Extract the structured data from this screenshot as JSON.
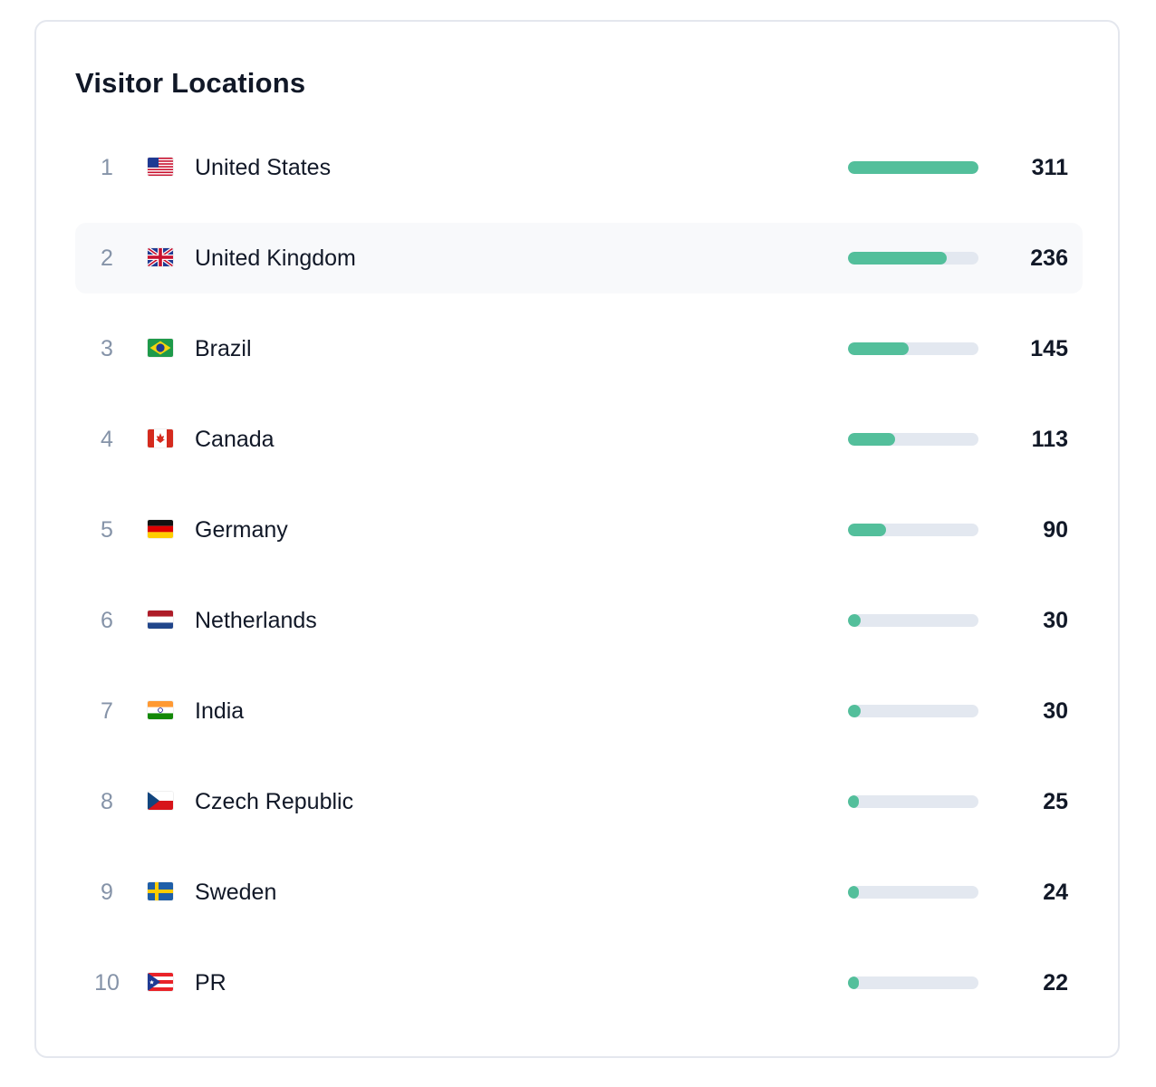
{
  "title": "Visitor Locations",
  "colors": {
    "bar_fill": "#53bf9b",
    "bar_track": "#e3e8f0",
    "row_highlight": "#f8f9fb",
    "rank_text": "#8593a8",
    "text": "#111827"
  },
  "max_value": 311,
  "rows": [
    {
      "rank": "1",
      "country": "United States",
      "flag": "flag-us-icon",
      "value": 311,
      "count": "311",
      "highlighted": false
    },
    {
      "rank": "2",
      "country": "United Kingdom",
      "flag": "flag-gb-icon",
      "value": 236,
      "count": "236",
      "highlighted": true
    },
    {
      "rank": "3",
      "country": "Brazil",
      "flag": "flag-br-icon",
      "value": 145,
      "count": "145",
      "highlighted": false
    },
    {
      "rank": "4",
      "country": "Canada",
      "flag": "flag-ca-icon",
      "value": 113,
      "count": "113",
      "highlighted": false
    },
    {
      "rank": "5",
      "country": "Germany",
      "flag": "flag-de-icon",
      "value": 90,
      "count": "90",
      "highlighted": false
    },
    {
      "rank": "6",
      "country": "Netherlands",
      "flag": "flag-nl-icon",
      "value": 30,
      "count": "30",
      "highlighted": false
    },
    {
      "rank": "7",
      "country": "India",
      "flag": "flag-in-icon",
      "value": 30,
      "count": "30",
      "highlighted": false
    },
    {
      "rank": "8",
      "country": "Czech Republic",
      "flag": "flag-cz-icon",
      "value": 25,
      "count": "25",
      "highlighted": false
    },
    {
      "rank": "9",
      "country": "Sweden",
      "flag": "flag-se-icon",
      "value": 24,
      "count": "24",
      "highlighted": false
    },
    {
      "rank": "10",
      "country": "PR",
      "flag": "flag-pr-icon",
      "value": 22,
      "count": "22",
      "highlighted": false
    }
  ]
}
